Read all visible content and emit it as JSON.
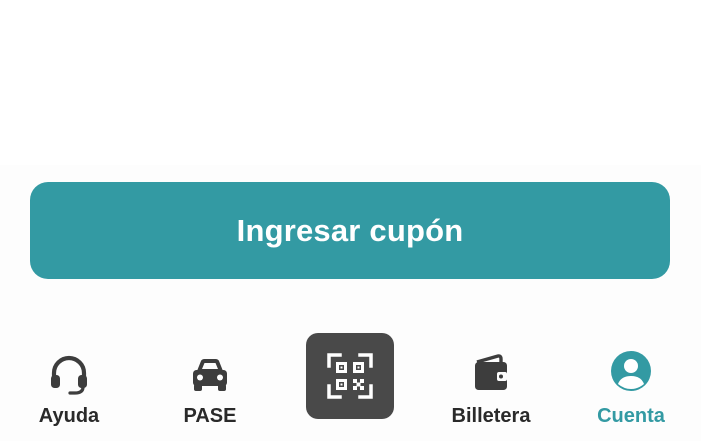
{
  "coupon": {
    "label": "Ingresar cupón"
  },
  "nav": {
    "items": [
      {
        "label": "Ayuda",
        "icon": "headset-icon"
      },
      {
        "label": "PASE",
        "icon": "car-icon"
      },
      {
        "label": "",
        "icon": "qr-scan-icon"
      },
      {
        "label": "Billetera",
        "icon": "wallet-icon"
      },
      {
        "label": "Cuenta",
        "icon": "account-icon",
        "active": true
      }
    ]
  },
  "colors": {
    "accent": "#339aa3",
    "scan_bg": "#494949",
    "text": "#2a2a2a",
    "icon": "#3d3d3d"
  }
}
